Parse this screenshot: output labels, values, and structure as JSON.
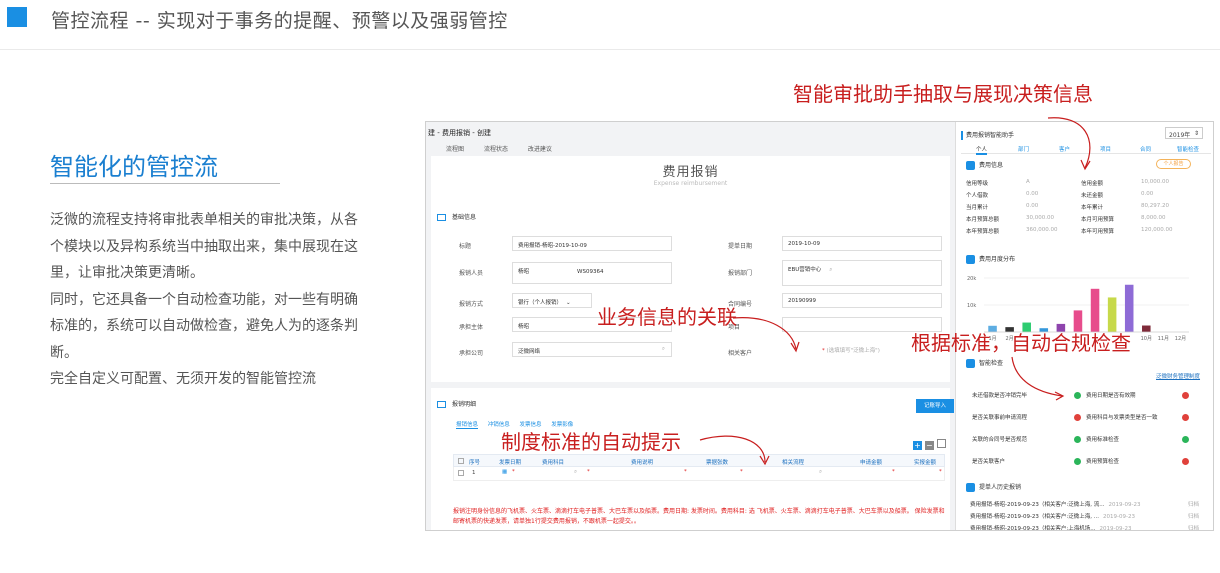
{
  "header": {
    "title": "管控流程 -- 实现对于事务的提醒、预警以及强弱管控"
  },
  "section": {
    "heading": "智能化的管控流",
    "paragraphs": [
      "泛微的流程支持将审批表单相关的审批决策，从各个模块以及异构系统当中抽取出来，集中展现在这里，让审批决策更清晰。",
      "同时，它还具备一个自动检查功能，对一些有明确标准的，系统可以自动做检查，避免人为的逐条判断。",
      "完全自定义可配置、无须开发的智能管控流"
    ]
  },
  "annotations": {
    "a1": "智能审批助手抽取与展现决策信息",
    "a2": "业务信息的关联",
    "a3": "根据标准，自动合规检查",
    "a4": "制度标准的自动提示"
  },
  "form": {
    "window_title": "建 - 费用报销 - 创建",
    "tabs": [
      "流程图",
      "流程状态",
      "改进建议"
    ],
    "title": "费用报销",
    "subtitle": "Expense reimbursement",
    "basic_section": "基础信息",
    "fields": {
      "title_label": "标题",
      "title_value": "费用报销-杨昭-2019-10-09",
      "date_label": "提单日期",
      "date_value": "2019-10-09",
      "person_label": "报销人员",
      "person_value": "杨昭",
      "person_code": "WS09364",
      "dept_label": "报销部门",
      "dept_value": "EBU营销中心",
      "method_label": "报销方式",
      "method_value": "银行（个人报销）",
      "contract_label": "合同编号",
      "contract_value": "20190999",
      "entity_label": "承担主体",
      "entity_value": "杨昭",
      "project_label": "项目",
      "company_label": "承担公司",
      "company_value": "泛微网络",
      "customer_label": "相关客户",
      "customer_placeholder": "(选填填写\"泛微上海\")"
    },
    "detail_section": "报销明细",
    "import_button": "记账导入",
    "detail_tabs": [
      "报销信息",
      "冲销信息",
      "发票信息",
      "发票影像"
    ],
    "columns": [
      "序号",
      "发票日期",
      "费用科目",
      "费用说明",
      "票据张数",
      "相关流程",
      "申请金额",
      "实报金额"
    ],
    "row": {
      "index": "1"
    },
    "notice": "报销注明身份信息的飞机票、火车票、滴滴打车电子普票、大巴车票以及船票。费用日期: 发票时间。费用科目: 选 飞机票、火车票、滴滴打车电子普票、大巴车票以及船票。  保险发票和邮寄机票的快递发票，请单独1行提交费用报销，不跟机票一起提交。。"
  },
  "assistant": {
    "title": "费用报销智能助手",
    "year": "2019年",
    "tabs": [
      "个人",
      "部门",
      "客户",
      "项目",
      "合同",
      "智能检查"
    ],
    "fee_section": "费用信息",
    "tag": "个人报告",
    "left_kv": [
      [
        "信用等级",
        "A"
      ],
      [
        "个人借款",
        "0.00"
      ],
      [
        "当月累计",
        "0.00"
      ],
      [
        "本月预算总额",
        "30,000.00"
      ],
      [
        "本年预算总额",
        "360,000.00"
      ]
    ],
    "right_kv": [
      [
        "信用金额",
        "10,000.00"
      ],
      [
        "未还金额",
        "0.00"
      ],
      [
        "本年累计",
        "80,297.20"
      ],
      [
        "本月可用预算",
        "8,000.00"
      ],
      [
        "本年可用预算",
        "120,000.00"
      ]
    ],
    "chart_section": "费用月度分布",
    "check_section": "智能检查",
    "check_link": "泛微财务管理制度",
    "checks_left": [
      [
        "未还借款是否冲销完毕",
        "green"
      ],
      [
        "是否关联事前申请流程",
        "red"
      ],
      [
        "关联的合同号是否规范",
        "green"
      ],
      [
        "是否关联客户",
        "green"
      ]
    ],
    "checks_right": [
      [
        "费用日期是否有效期",
        "red"
      ],
      [
        "费用科目与发票类型是否一致",
        "red"
      ],
      [
        "费用标准检查",
        "green"
      ],
      [
        "费用预算检查",
        "red"
      ]
    ],
    "history_section": "提单人历史报销",
    "history": [
      [
        "费用报销-杨昭-2019-09-23（相关客户:泛微上海, 流...",
        "2019-09-23",
        "归档"
      ],
      [
        "费用报销-杨昭-2019-09-23（相关客户:泛微上海, ...",
        "2019-09-23",
        "归档"
      ],
      [
        "费用报销-杨昭-2019-09-23（相关客户:上海机场...",
        "2019-09-23",
        "归档"
      ]
    ]
  },
  "chart_data": {
    "type": "bar",
    "title": "费用月度分布",
    "categories": [
      "1月",
      "2月",
      "3月",
      "4月",
      "5月",
      "6月",
      "7月",
      "8月",
      "9月",
      "10月",
      "11月",
      "12月"
    ],
    "values": [
      2300,
      1800,
      3500,
      1400,
      3000,
      8000,
      16000,
      12800,
      17500,
      2400,
      0,
      0
    ],
    "colors": [
      "#5dade2",
      "#333333",
      "#2ecc71",
      "#3498db",
      "#8e44ad",
      "#e74c8c",
      "#e74c8c",
      "#c7d94a",
      "#8e6bd6",
      "#7f2b3a",
      "#5dade2",
      "#5dade2"
    ],
    "ylim": [
      0,
      20000
    ],
    "yticks": [
      "20k",
      "10k"
    ],
    "xticks": [
      "1月",
      "2月",
      "10月",
      "11月",
      "12月"
    ]
  }
}
